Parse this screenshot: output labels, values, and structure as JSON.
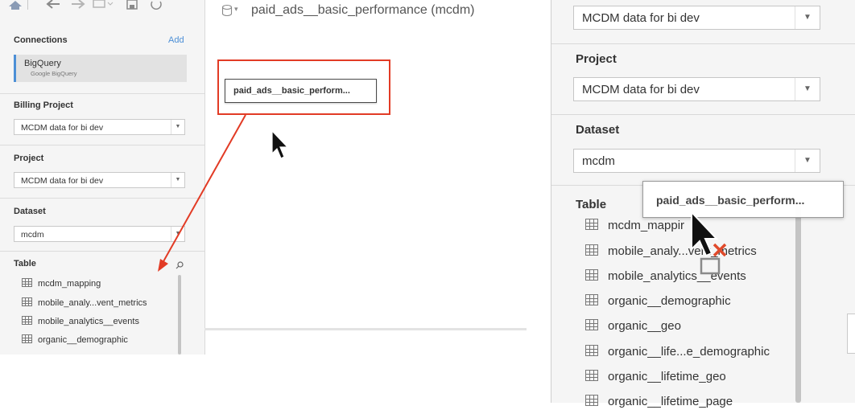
{
  "colors": {
    "accent": "#4c8fd6",
    "annotation": "#e23b25",
    "remove": "#e04a2b"
  },
  "toolbar": {
    "icons": [
      "home-icon",
      "back-icon",
      "forward-icon",
      "datasource-icon",
      "save-icon",
      "refresh-icon"
    ]
  },
  "sidebar": {
    "connections_title": "Connections",
    "add_label": "Add",
    "connection": {
      "name": "BigQuery",
      "type": "Google BigQuery"
    },
    "billing_project": {
      "title": "Billing Project",
      "value": "MCDM data for bi dev"
    },
    "project": {
      "title": "Project",
      "value": "MCDM data for bi dev"
    },
    "dataset": {
      "title": "Dataset",
      "value": "mcdm"
    },
    "table_title": "Table",
    "tables": [
      "mcdm_mapping",
      "mobile_analy...vent_metrics",
      "mobile_analytics__events",
      "organic__demographic"
    ]
  },
  "canvas": {
    "datasource_title": "paid_ads__basic_performance (mcdm)",
    "table_card": "paid_ads__basic_perform..."
  },
  "zoom": {
    "billing_project_value": "MCDM data for bi dev",
    "project": {
      "title": "Project",
      "value": "MCDM data for bi dev"
    },
    "dataset": {
      "title": "Dataset",
      "value": "mcdm"
    },
    "table_title": "Table",
    "drag_card": "paid_ads__basic_perform...",
    "tables": [
      "mcdm_mappir",
      "mobile_analy...vent_metrics",
      "mobile_analytics__events",
      "organic__demographic",
      "organic__geo",
      "organic__life...e_demographic",
      "organic__lifetime_geo",
      "organic__lifetime_page"
    ]
  }
}
